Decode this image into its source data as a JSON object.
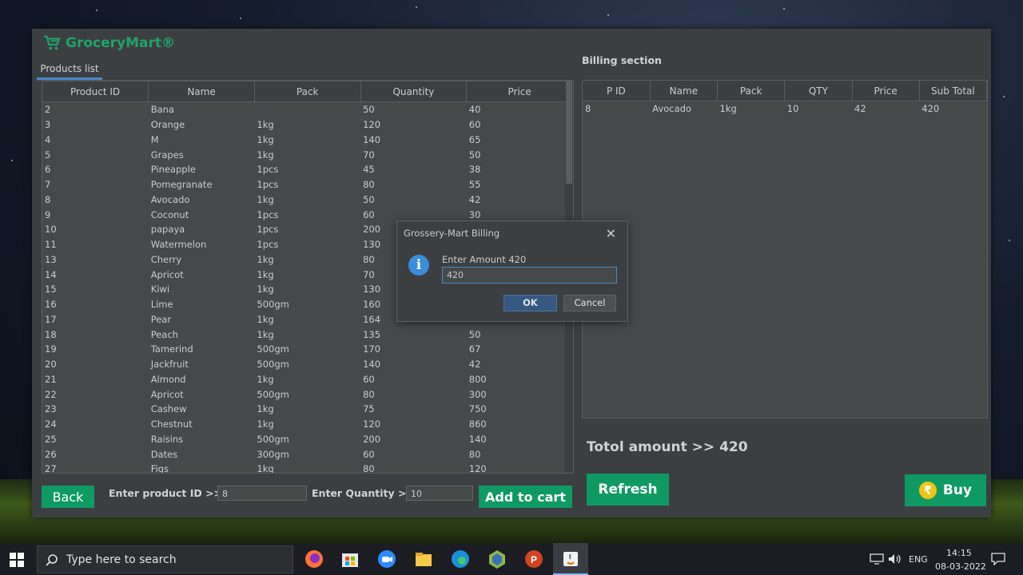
{
  "app": {
    "title": "GroceryMart®",
    "tab_label": "Products list",
    "billing_title": "Billing section",
    "total_label": "Totol amount >> 420"
  },
  "products": {
    "columns": [
      "Product ID",
      "Name",
      "Pack",
      "Quantity",
      "Price"
    ],
    "rows": [
      [
        "2",
        "Bana",
        "",
        "50",
        "40"
      ],
      [
        "3",
        "Orange",
        "1kg",
        "120",
        "60"
      ],
      [
        "4",
        "M",
        "1kg",
        "140",
        "65"
      ],
      [
        "5",
        "Grapes",
        "1kg",
        "70",
        "50"
      ],
      [
        "6",
        "Pineapple",
        "1pcs",
        "45",
        "38"
      ],
      [
        "7",
        "Pomegranate",
        "1pcs",
        "80",
        "55"
      ],
      [
        "8",
        "Avocado",
        "1kg",
        "50",
        "42"
      ],
      [
        "9",
        "Coconut",
        "1pcs",
        "60",
        "30"
      ],
      [
        "10",
        "papaya",
        "1pcs",
        "200",
        ""
      ],
      [
        "11",
        "Watermelon",
        "1pcs",
        "130",
        ""
      ],
      [
        "13",
        "Cherry",
        "1kg",
        "80",
        ""
      ],
      [
        "14",
        "Apricot",
        "1kg",
        "70",
        ""
      ],
      [
        "15",
        "Kiwi",
        "1kg",
        "130",
        ""
      ],
      [
        "16",
        "Lime",
        "500gm",
        "160",
        ""
      ],
      [
        "17",
        "Pear",
        "1kg",
        "164",
        ""
      ],
      [
        "18",
        "Peach",
        "1kg",
        "135",
        "50"
      ],
      [
        "19",
        "Tamerind",
        "500gm",
        "170",
        "67"
      ],
      [
        "20",
        "Jackfruit",
        "500gm",
        "140",
        "42"
      ],
      [
        "21",
        "Almond",
        "1kg",
        "60",
        "800"
      ],
      [
        "22",
        "Apricot",
        "500gm",
        "80",
        "300"
      ],
      [
        "23",
        "Cashew",
        "1kg",
        "75",
        "750"
      ],
      [
        "24",
        "Chestnut",
        "1kg",
        "120",
        "860"
      ],
      [
        "25",
        "Raisins",
        "500gm",
        "200",
        "140"
      ],
      [
        "26",
        "Dates",
        "300gm",
        "60",
        "80"
      ],
      [
        "27",
        "Figs",
        "1kg",
        "80",
        "120"
      ]
    ]
  },
  "billing": {
    "columns": [
      "P ID",
      "Name",
      "Pack",
      "QTY",
      "Price",
      "Sub Total"
    ],
    "rows": [
      [
        "8",
        "Avocado",
        "1kg",
        "10",
        "42",
        "420"
      ]
    ]
  },
  "controls": {
    "back_label": "Back",
    "product_id_label": "Enter product ID >>",
    "product_id_value": "8",
    "quantity_label": "Enter Quantity >>",
    "quantity_value": "10",
    "add_to_cart_label": "Add to cart",
    "refresh_label": "Refresh",
    "buy_label": "Buy",
    "buy_icon": "rupee-icon"
  },
  "dialog": {
    "title": "Grossery-Mart Billing",
    "message": "Enter Amount  420",
    "input_value": "420",
    "ok_label": "OK",
    "cancel_label": "Cancel",
    "icon": "info-icon"
  },
  "taskbar": {
    "search_placeholder": "Type here to search",
    "language": "ENG",
    "time": "14:15",
    "date": "08-03-2022"
  },
  "colors": {
    "accent_green": "#0f9a64",
    "panel": "#3c3f41",
    "dialog_ok": "#365880",
    "tab_underline": "#4a88c7"
  }
}
